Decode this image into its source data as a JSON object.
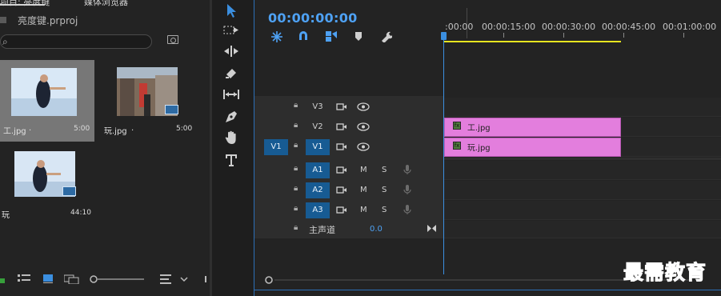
{
  "project": {
    "tab1": "项目: 亮度键",
    "tab2": "媒体浏览器",
    "name": "亮度键.prproj",
    "search_glyph": "⌕",
    "items": [
      {
        "name": "工.jpg",
        "dot": ".",
        "duration": "5:00"
      },
      {
        "name": "玩.jpg",
        "dot": ".",
        "duration": "5:00"
      },
      {
        "name": "玩",
        "duration": "44:10"
      }
    ]
  },
  "timeline": {
    "timecode": "00:00:00:00",
    "ruler": [
      ":00:00",
      "00:00:15:00",
      "00:00:30:00",
      "00:00:45:00",
      "00:01:00:00"
    ],
    "video_tracks": [
      {
        "id": "V3",
        "source": "",
        "active": false
      },
      {
        "id": "V2",
        "source": "",
        "active": false
      },
      {
        "id": "V1",
        "source": "V1",
        "active": true
      }
    ],
    "audio_tracks": [
      {
        "id": "A1",
        "m": "M",
        "s": "S"
      },
      {
        "id": "A2",
        "m": "M",
        "s": "S"
      },
      {
        "id": "A3",
        "m": "M",
        "s": "S"
      }
    ],
    "master": {
      "label": "主声道",
      "value": "0.0"
    },
    "clips": [
      {
        "track": "V2",
        "name": "工.jpg",
        "color": "#e37edd"
      },
      {
        "track": "V1",
        "name": "玩.jpg",
        "color": "#e37edd"
      }
    ]
  },
  "watermark": "最需教育",
  "colors": {
    "accent": "#4ea1f3",
    "track_active": "#175b93",
    "clip": "#e37edd",
    "workarea": "#e7e51f"
  }
}
